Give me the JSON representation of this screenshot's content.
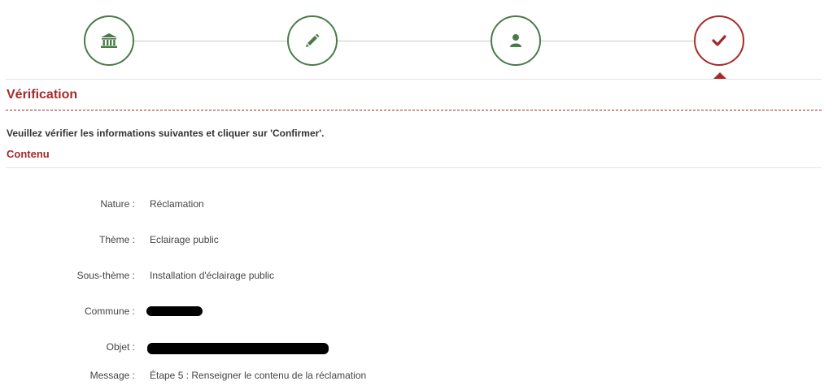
{
  "colors": {
    "step_done": "#4a7a4a",
    "step_active": "#a52a2a",
    "accent": "#a52a2a",
    "line": "#c8c8c8"
  },
  "stepper": {
    "steps": [
      {
        "icon": "bank-icon",
        "state": "done"
      },
      {
        "icon": "pencil-icon",
        "state": "done"
      },
      {
        "icon": "user-icon",
        "state": "done"
      },
      {
        "icon": "check-icon",
        "state": "active"
      }
    ]
  },
  "section": {
    "title": "Vérification",
    "instructions": "Veuillez vérifier les informations suivantes et cliquer sur 'Confirmer'.",
    "subtitle": "Contenu"
  },
  "fields": [
    {
      "label": "Nature :",
      "value": "Réclamation"
    },
    {
      "label": "Thème :",
      "value": "Eclairage public"
    },
    {
      "label": "Sous-thème :",
      "value": "Installation d'éclairage public"
    },
    {
      "label": "Commune :",
      "value": ""
    },
    {
      "label": "Objet :",
      "value": ""
    },
    {
      "label": "Message :",
      "value": "Étape 5 : Renseigner le contenu de la réclamation"
    }
  ]
}
